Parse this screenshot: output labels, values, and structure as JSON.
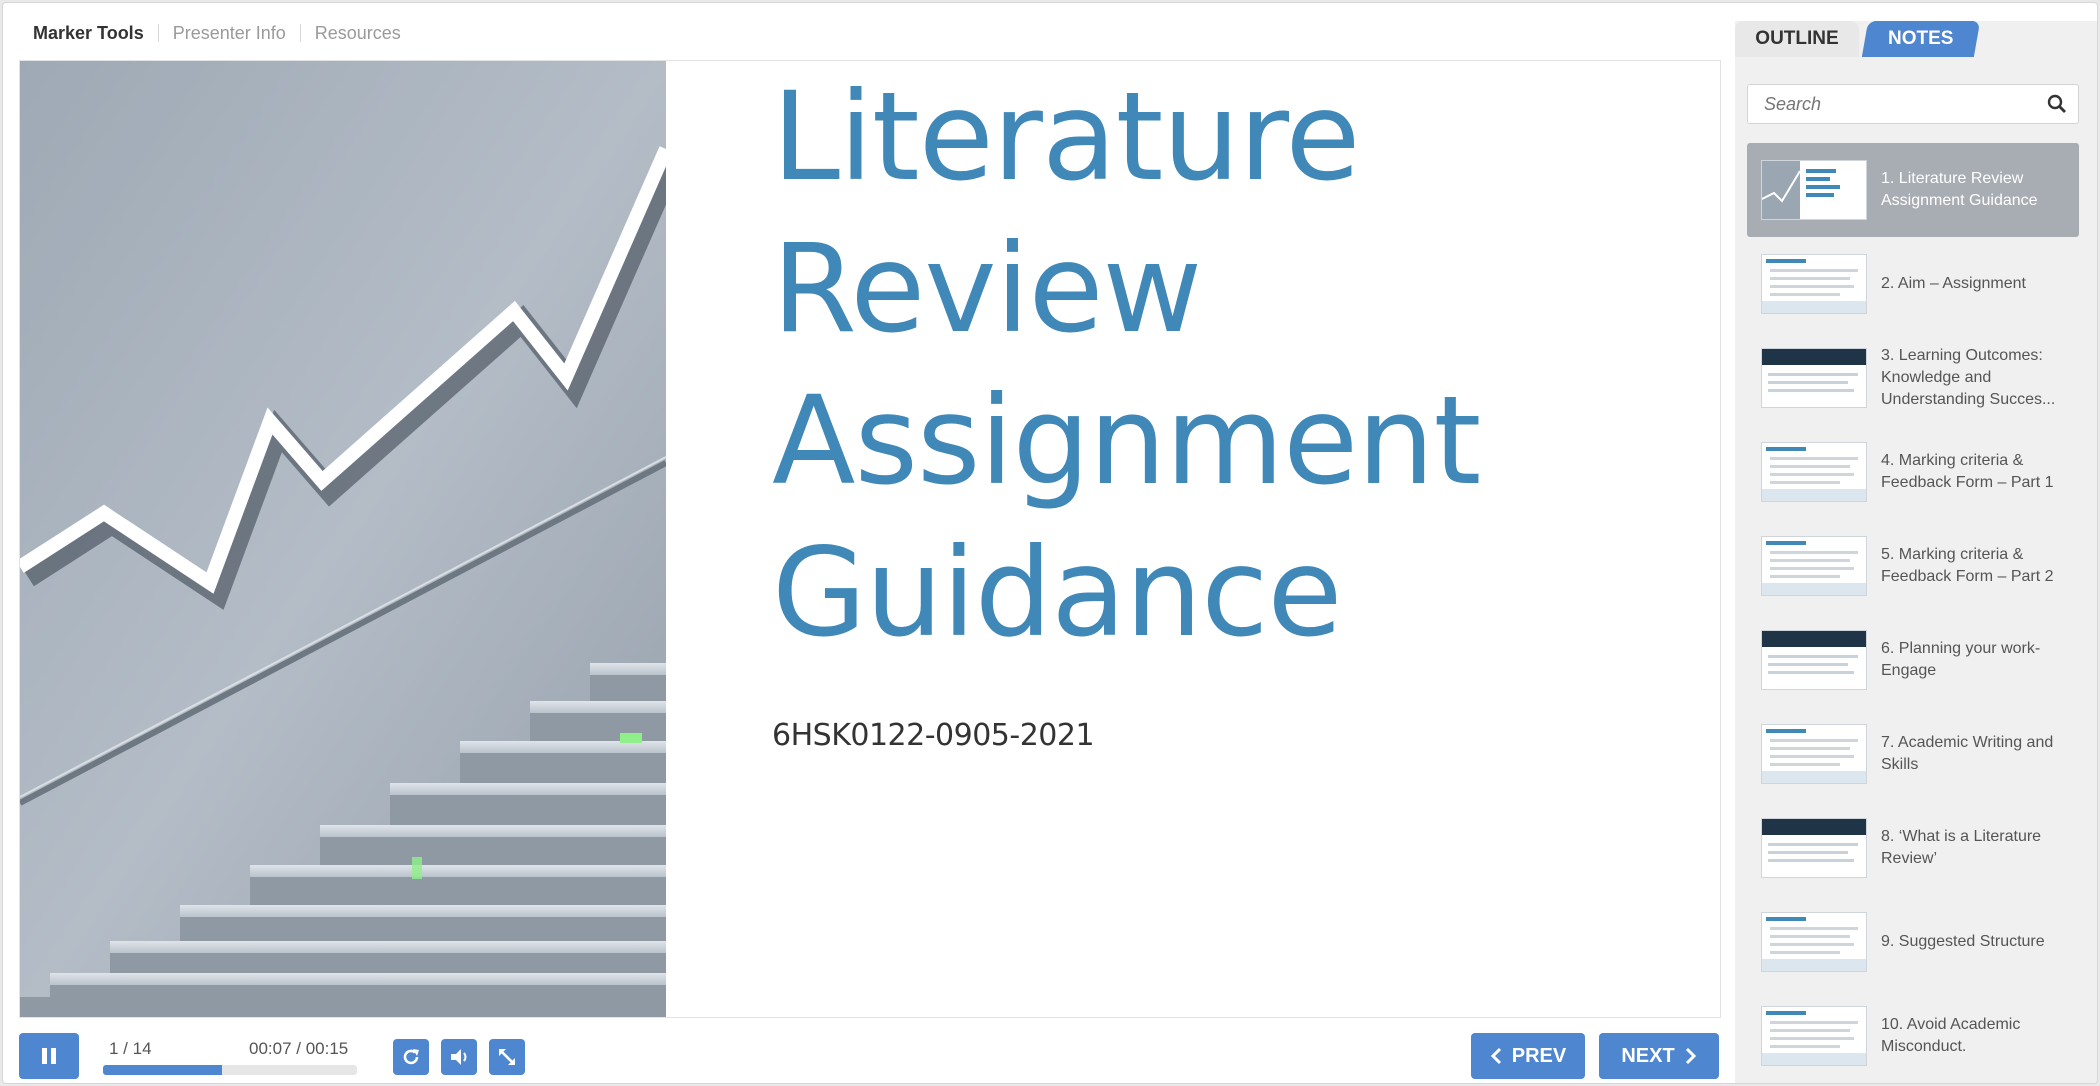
{
  "topnav": {
    "items": [
      "Marker Tools",
      "Presenter Info",
      "Resources"
    ]
  },
  "slide": {
    "title_lines": [
      "Literature",
      "Review",
      "Assignment",
      "Guidance"
    ],
    "subtitle": "6HSK0122-0905-2021",
    "accent": "#3f88b8"
  },
  "player": {
    "slide_counter": "1 / 14",
    "time": "00:07 / 00:15",
    "progress_fraction": 0.47,
    "prev_label": "PREV",
    "next_label": "NEXT",
    "accent": "#4f86d0"
  },
  "sidebar": {
    "tabs": {
      "outline": "OUTLINE",
      "notes": "NOTES"
    },
    "search_placeholder": "Search",
    "items": [
      {
        "label": "1. Literature Review Assignment Guidance",
        "active": true
      },
      {
        "label": "2. Aim – Assignment"
      },
      {
        "label": "3. Learning Outcomes: Knowledge and Understanding Succes..."
      },
      {
        "label": "4. Marking criteria & Feedback Form – Part 1"
      },
      {
        "label": "5. Marking criteria & Feedback Form – Part 2"
      },
      {
        "label": "6. Planning your work- Engage"
      },
      {
        "label": "7. Academic Writing and Skills"
      },
      {
        "label": "8. ‘What is a Literature Review’"
      },
      {
        "label": "9. Suggested Structure"
      },
      {
        "label": "10. Avoid Academic Misconduct."
      }
    ]
  },
  "icons": [
    "pause-icon",
    "replay-icon",
    "volume-icon",
    "fullscreen-icon",
    "search-icon",
    "chevron-left-icon",
    "chevron-right-icon"
  ]
}
